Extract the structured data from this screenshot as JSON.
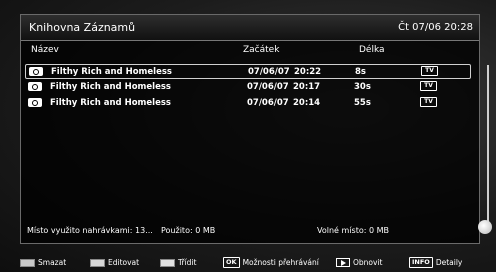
{
  "header": {
    "title": "Knihovna Záznamů",
    "datetime": "Čt 07/06 20:28"
  },
  "columns": {
    "name": "Název",
    "start": "Začátek",
    "length": "Délka"
  },
  "recordings": [
    {
      "name": "Filthy Rich and Homeless",
      "date": "07/06/07",
      "time": "20:22",
      "length": "8s",
      "badge": "TV",
      "selected": true
    },
    {
      "name": "Filthy Rich and Homeless",
      "date": "07/06/07",
      "time": "20:17",
      "length": "30s",
      "badge": "TV",
      "selected": false
    },
    {
      "name": "Filthy Rich and Homeless",
      "date": "07/06/07",
      "time": "20:14",
      "length": "55s",
      "badge": "TV",
      "selected": false
    }
  ],
  "status": {
    "space_used": "Místo využito nahrávkami: 13...",
    "used": "Použito: 0 MB",
    "free": "Volné místo: 0 MB"
  },
  "footer": {
    "delete": {
      "label": "Smazat",
      "color": "#c8c8c8"
    },
    "edit": {
      "label": "Editovat",
      "color": "#d8d8d8"
    },
    "sort": {
      "label": "Třídit",
      "color": "#e0e0e0"
    },
    "options_key": "OK",
    "options": "Možnosti přehrávání",
    "refresh": "Obnovit",
    "info_key": "INFO",
    "details": "Detaily"
  }
}
